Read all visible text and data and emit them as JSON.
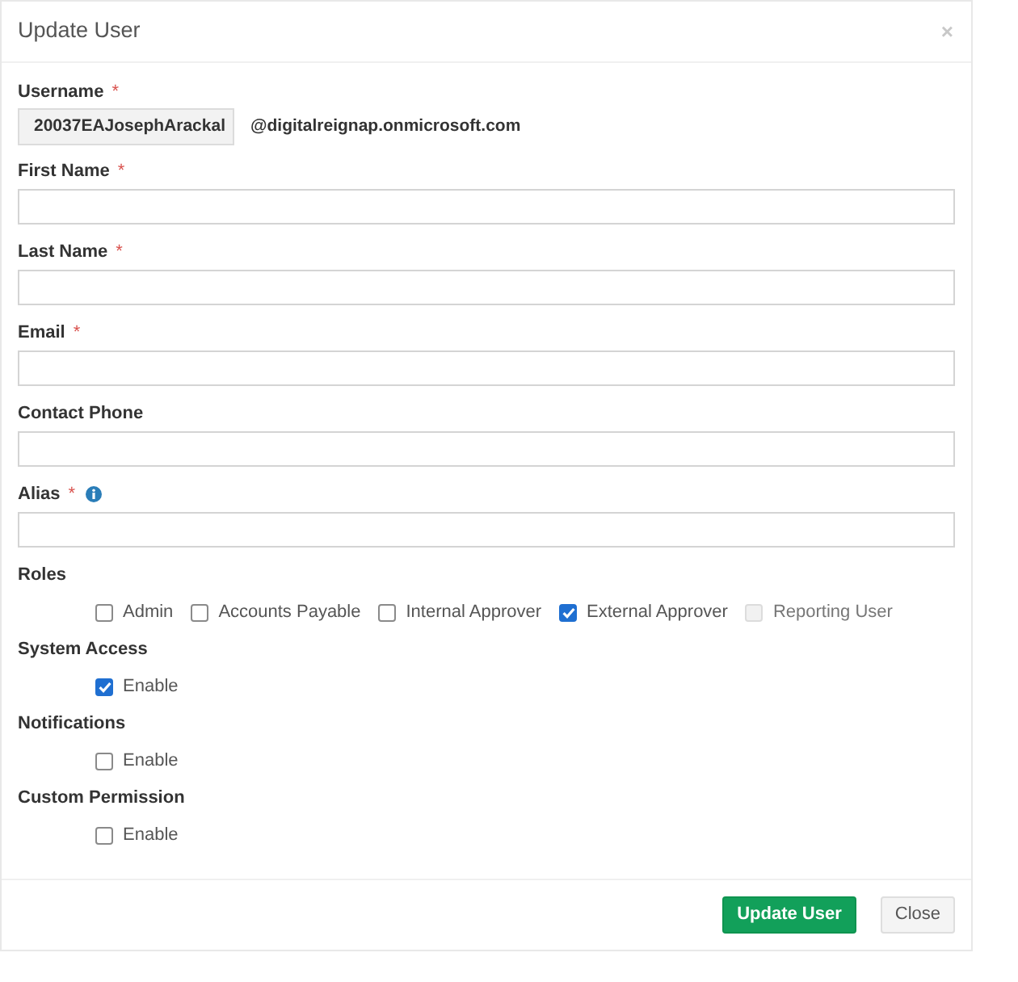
{
  "dialog": {
    "title": "Update User",
    "close_glyph": "×"
  },
  "username": {
    "label": "Username",
    "required_mark": "*",
    "value": "20037EAJosephArackal",
    "domain": "@digitalreignap.onmicrosoft.com"
  },
  "fields": [
    {
      "label": "First Name",
      "required_mark": "*",
      "info": false
    },
    {
      "label": "Last Name",
      "required_mark": "*",
      "info": false
    },
    {
      "label": "Email",
      "required_mark": "*",
      "info": false
    },
    {
      "label": "Contact Phone",
      "info": false
    },
    {
      "label": "Alias",
      "required_mark": "*",
      "info": true
    }
  ],
  "roles": {
    "label": "Roles",
    "options": [
      {
        "label": "Admin",
        "checked": false,
        "disabled": false
      },
      {
        "label": "Accounts Payable",
        "checked": false,
        "disabled": false
      },
      {
        "label": "Internal Approver",
        "checked": false,
        "disabled": false
      },
      {
        "label": "External Approver",
        "checked": true,
        "disabled": false
      },
      {
        "label": "Reporting User",
        "checked": false,
        "disabled": true
      }
    ]
  },
  "toggles": [
    {
      "label": "System Access",
      "option": {
        "label": "Enable",
        "checked": true
      }
    },
    {
      "label": "Notifications",
      "option": {
        "label": "Enable",
        "checked": false
      }
    },
    {
      "label": "Custom Permission",
      "option": {
        "label": "Enable",
        "checked": false
      }
    }
  ],
  "buttons": [
    {
      "label": "Update User",
      "kind": "primary"
    },
    {
      "label": "Close",
      "kind": "secondary"
    }
  ]
}
